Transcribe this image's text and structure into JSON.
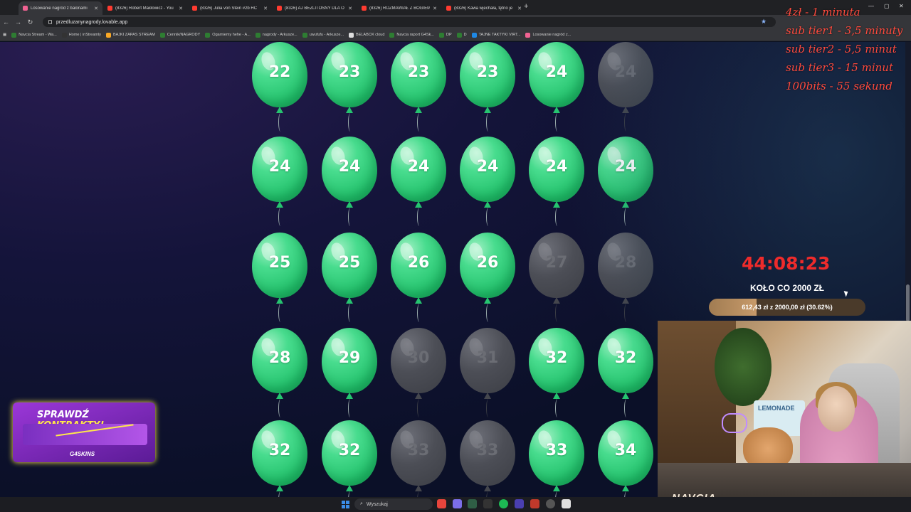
{
  "browser": {
    "tabs": [
      {
        "label": "Losowanie nagród z balonami",
        "active": true
      },
      {
        "label": "(8326) Robert Makłowicz - You"
      },
      {
        "label": "(8326) Julia von Stein #2b HC"
      },
      {
        "label": "(8326) AJ BEZLITOSNY DLA O"
      },
      {
        "label": "(8326) ROZMAWIAŁ Z BOGIEM"
      },
      {
        "label": "(8326) Kawa wjechała, tętno je"
      }
    ],
    "url": "przedluzanynagrody.lovable.app",
    "bookmarks": [
      {
        "label": "Navcia Stream - Wa...",
        "color": "#2e7d32"
      },
      {
        "label": "Home | inStreamly",
        "color": "#333"
      },
      {
        "label": "BAJKI ZAPAS STREAM",
        "color": "#f9a825"
      },
      {
        "label": "Cennik/NAGRODY",
        "color": "#2e7d32"
      },
      {
        "label": "Ogarniemy hehe - A...",
        "color": "#2e7d32"
      },
      {
        "label": "nagrody - Arkusze...",
        "color": "#2e7d32"
      },
      {
        "label": "uwufufu - Arkusze...",
        "color": "#2e7d32"
      },
      {
        "label": "BELABOX cloud",
        "color": "#ddd"
      },
      {
        "label": "Navcia raport G4Sk...",
        "color": "#2e7d32"
      },
      {
        "label": "DP",
        "color": "#2e7d32"
      },
      {
        "label": "D",
        "color": "#2e7d32"
      },
      {
        "label": "TAJNE TAKTYKI VIRT...",
        "color": "#1e88e5"
      },
      {
        "label": "Losowanie nagród z...",
        "color": "#f06292"
      }
    ]
  },
  "balloons": [
    {
      "n": "22",
      "popped": false
    },
    {
      "n": "23",
      "popped": false
    },
    {
      "n": "23",
      "popped": false
    },
    {
      "n": "23",
      "popped": false
    },
    {
      "n": "24",
      "popped": false
    },
    {
      "n": "24",
      "popped": true
    },
    {
      "n": "24",
      "popped": false
    },
    {
      "n": "24",
      "popped": false
    },
    {
      "n": "24",
      "popped": false
    },
    {
      "n": "24",
      "popped": false
    },
    {
      "n": "24",
      "popped": false
    },
    {
      "n": "24",
      "popped": false
    },
    {
      "n": "25",
      "popped": false
    },
    {
      "n": "25",
      "popped": false
    },
    {
      "n": "26",
      "popped": false
    },
    {
      "n": "26",
      "popped": false
    },
    {
      "n": "27",
      "popped": true
    },
    {
      "n": "28",
      "popped": true
    },
    {
      "n": "28",
      "popped": false
    },
    {
      "n": "29",
      "popped": false
    },
    {
      "n": "30",
      "popped": true
    },
    {
      "n": "31",
      "popped": true
    },
    {
      "n": "32",
      "popped": false
    },
    {
      "n": "32",
      "popped": false
    },
    {
      "n": "32",
      "popped": false
    },
    {
      "n": "32",
      "popped": false
    },
    {
      "n": "33",
      "popped": true
    },
    {
      "n": "33",
      "popped": true
    },
    {
      "n": "33",
      "popped": false
    },
    {
      "n": "34",
      "popped": false
    }
  ],
  "overlay": {
    "price_list": [
      "4zł - 1 minuta",
      "sub tier1 - 3,5 minuty",
      "sub tier2 - 5,5 minut",
      "sub tier3 - 15 minut",
      "100bits - 55 sekund"
    ],
    "timer": "44:08:23",
    "wheel_title": "KOŁO CO 2000 ZŁ",
    "progress_text": "612,43 zł z 2000,00 zł (30.62%)",
    "progress_fraction": 0.3062,
    "promo_title_a": "SPRAWDŹ",
    "promo_title_b": "KONTRAKTY!",
    "promo_brand": "G4SKINS",
    "webcam_name": "NAVCIA",
    "webcam_sign": "LEMONADE"
  },
  "taskbar": {
    "search_placeholder": "Wyszukaj"
  }
}
